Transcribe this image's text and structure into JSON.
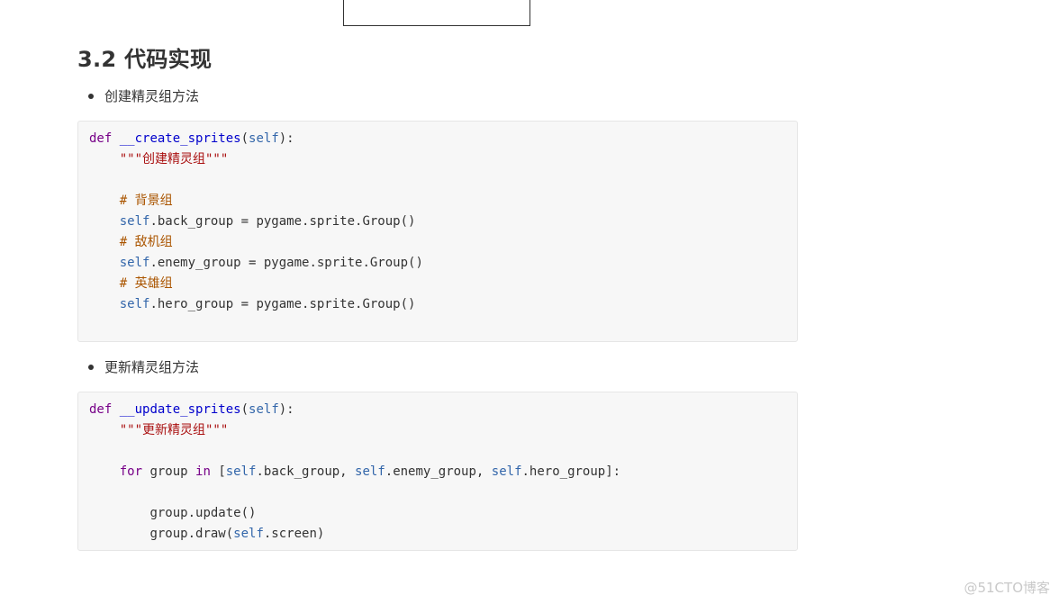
{
  "section_title": "3.2 代码实现",
  "bullets": [
    "创建精灵组方法",
    "更新精灵组方法"
  ],
  "code1": {
    "def": "def",
    "fn_name": "__create_sprites",
    "self_param": "self",
    "paren_open": "(",
    "paren_close": "):",
    "docstring": "\"\"\"创建精灵组\"\"\"",
    "comment_back": "# 背景组",
    "back_rest": ".back_group = pygame.sprite.Group()",
    "comment_enemy": "# 敌机组",
    "enemy_rest": ".enemy_group = pygame.sprite.Group()",
    "comment_hero": "# 英雄组",
    "hero_rest": ".hero_group = pygame.sprite.Group()"
  },
  "code2": {
    "def": "def",
    "fn_name": "__update_sprites",
    "self_param": "self",
    "docstring": "\"\"\"更新精灵组\"\"\"",
    "for_kw": "for",
    "group_var": " group ",
    "in_kw": "in",
    "list_open": " [",
    "back": ".back_group, ",
    "enemy": ".enemy_group, ",
    "hero": ".hero_group]:",
    "update_call": "group.update()",
    "draw_call": "group.draw(",
    "screen": ".screen)"
  },
  "self_kw": "self",
  "watermark": "@51CTO博客"
}
